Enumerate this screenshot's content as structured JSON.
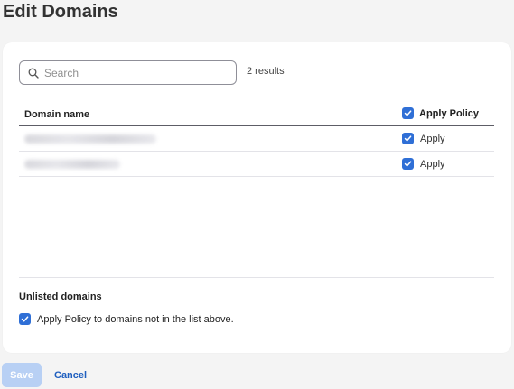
{
  "page": {
    "title": "Edit Domains"
  },
  "search": {
    "placeholder": "Search",
    "value": "",
    "results_count": "2 results"
  },
  "table": {
    "columns": {
      "domain_name": "Domain name",
      "apply_policy": "Apply Policy"
    },
    "apply_policy_all_checked": true,
    "rows": [
      {
        "domain": "",
        "apply_label": "Apply",
        "checked": true
      },
      {
        "domain": "",
        "apply_label": "Apply",
        "checked": true
      }
    ]
  },
  "unlisted": {
    "title": "Unlisted domains",
    "option_label": "Apply Policy to domains not in the list above.",
    "checked": true
  },
  "footer": {
    "save_label": "Save",
    "cancel_label": "Cancel"
  },
  "colors": {
    "accent": "#2f6fd6",
    "save_disabled_bg": "#b8d0f4",
    "link": "#1f5fbf",
    "page_bg": "#f4f4f4"
  }
}
